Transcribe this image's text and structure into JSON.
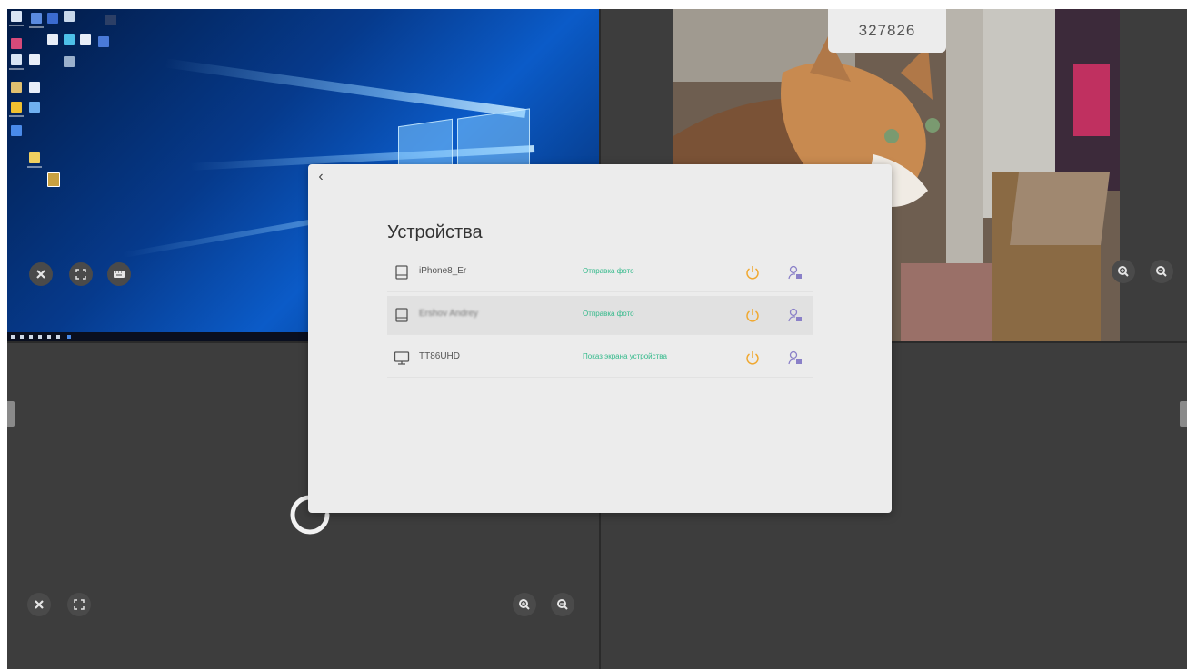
{
  "desktop_panel": {
    "controls": [
      "close-icon",
      "fullscreen-icon",
      "keyboard-icon"
    ]
  },
  "photo_panel": {
    "code": "327826",
    "controls": [
      "zoom-in-icon",
      "zoom-out-icon"
    ]
  },
  "empty_panel": {
    "controls": [
      "close-icon",
      "fullscreen-icon",
      "zoom-in-icon",
      "zoom-out-icon"
    ]
  },
  "devices_dialog": {
    "back_icon": "chevron-left-icon",
    "title": "Устройства",
    "devices": [
      {
        "name": "iPhone8_Er",
        "status": "Отправка фото",
        "icon": "tablet-icon",
        "selected": false
      },
      {
        "name": "Ershov Andrey",
        "status": "Отправка фото",
        "icon": "tablet-icon",
        "selected": true
      },
      {
        "name": "TT86UHD",
        "status": "Показ экрана устройства",
        "icon": "monitor-icon",
        "selected": false
      }
    ]
  },
  "colors": {
    "status_green": "#32b98a",
    "power_orange": "#f0a830",
    "user_purple": "#8a80c8",
    "dialog_bg": "#ececec",
    "screen_bg": "#3d3d3d"
  }
}
